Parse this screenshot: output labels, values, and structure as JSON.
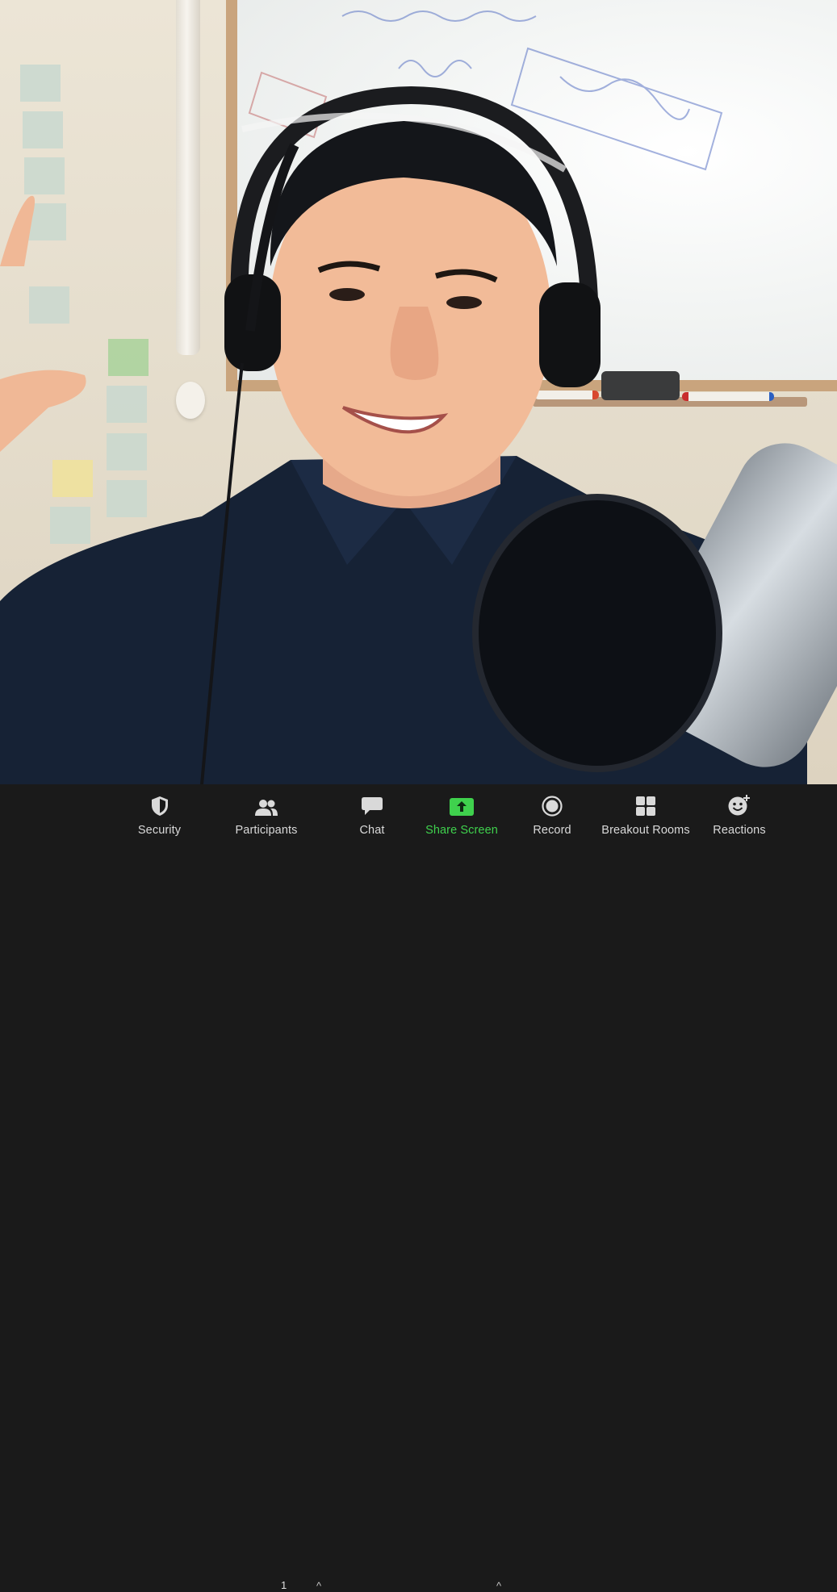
{
  "video": {
    "participant": "presenter"
  },
  "toolbar": {
    "security_label": "Security",
    "participants_label": "Participants",
    "participants_count": "1",
    "chat_label": "Chat",
    "share_label": "Share Screen",
    "record_label": "Record",
    "breakout_label": "Breakout Rooms",
    "reactions_label": "Reactions"
  },
  "icons": {
    "security": "shield-icon",
    "participants": "people-icon",
    "chat": "chat-bubble-icon",
    "share": "share-screen-icon",
    "record": "record-icon",
    "breakout": "grid-icon",
    "reactions": "smiley-plus-icon"
  },
  "colors": {
    "toolbar_bg": "#1a1a1a",
    "toolbar_text": "#d9d9d9",
    "share_accent": "#3fd14d"
  }
}
